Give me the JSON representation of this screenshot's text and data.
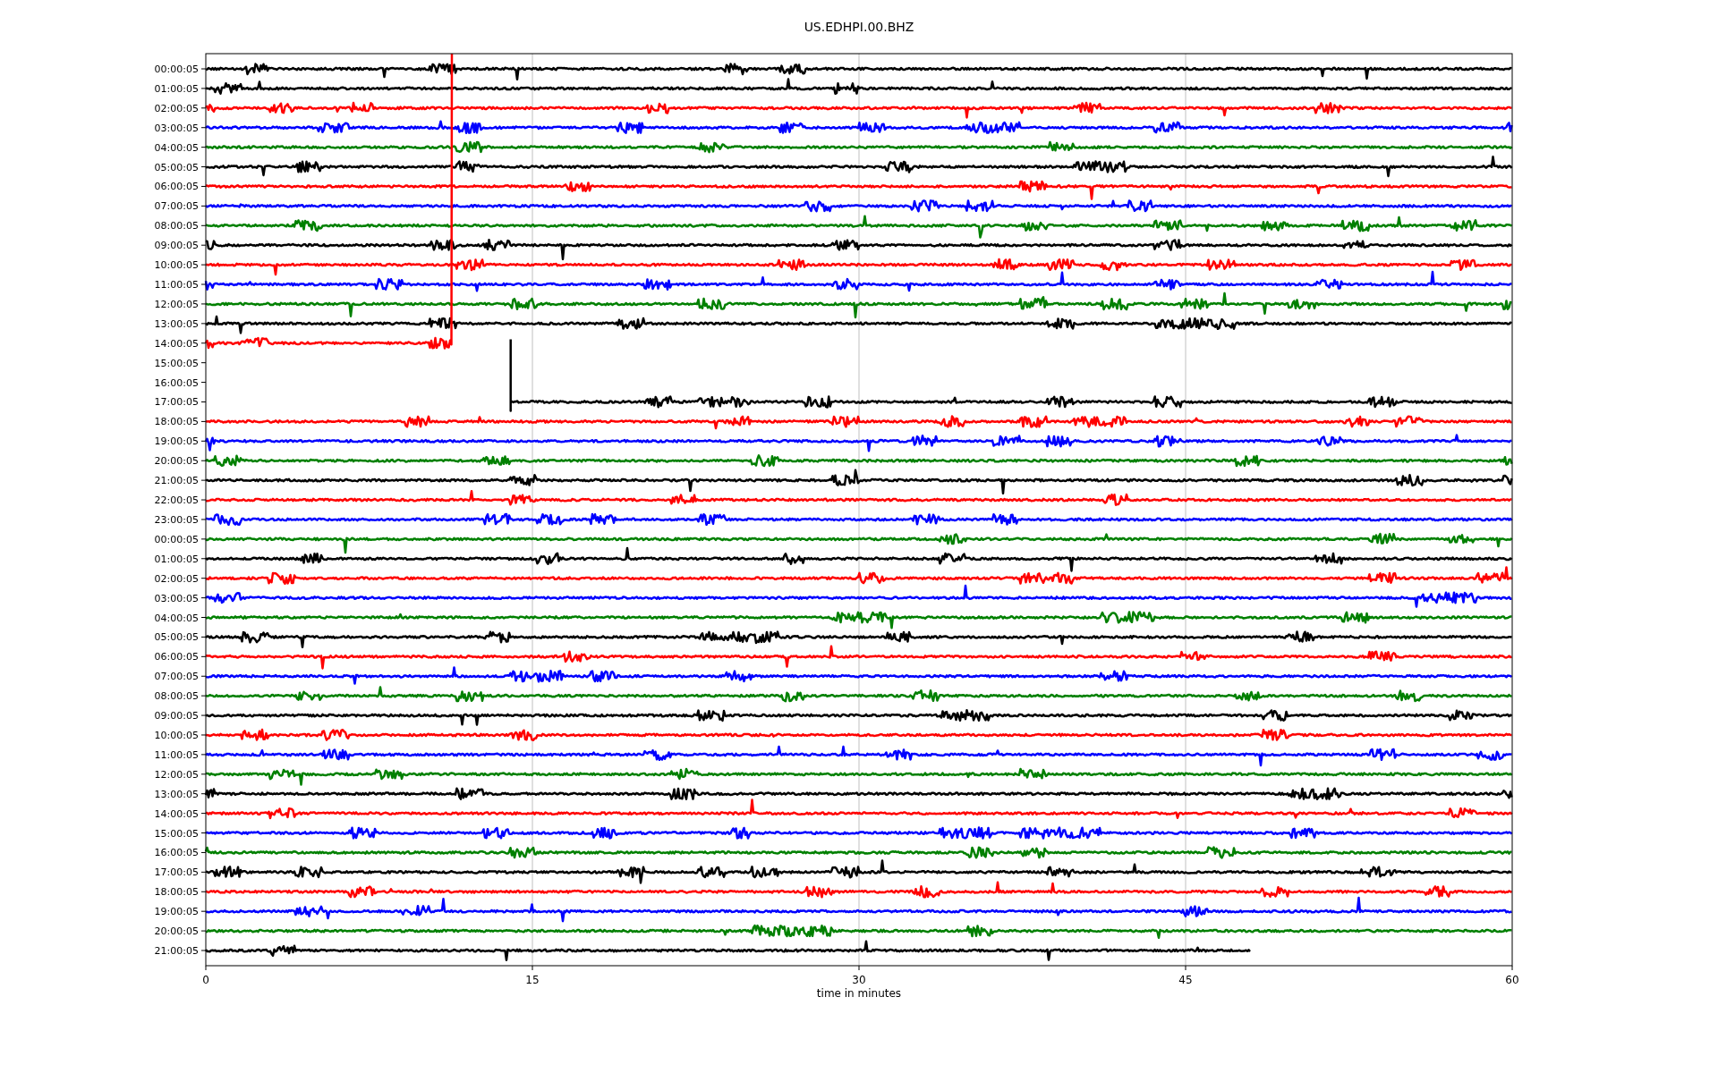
{
  "title": "US.EDHPI.00.BHZ",
  "xlabel": "time in minutes",
  "xticks": [
    "0",
    "15",
    "30",
    "45",
    "60"
  ],
  "rows": [
    {
      "label": "00:00:05",
      "color": "#000000",
      "kind": "full"
    },
    {
      "label": "01:00:05",
      "color": "#000000",
      "kind": "full"
    },
    {
      "label": "02:00:05",
      "color": "#ff0000",
      "kind": "full"
    },
    {
      "label": "03:00:05",
      "color": "#0000ff",
      "kind": "full"
    },
    {
      "label": "04:00:05",
      "color": "#008000",
      "kind": "full"
    },
    {
      "label": "05:00:05",
      "color": "#000000",
      "kind": "full"
    },
    {
      "label": "06:00:05",
      "color": "#ff0000",
      "kind": "full"
    },
    {
      "label": "07:00:05",
      "color": "#0000ff",
      "kind": "full"
    },
    {
      "label": "08:00:05",
      "color": "#008000",
      "kind": "full"
    },
    {
      "label": "09:00:05",
      "color": "#000000",
      "kind": "full"
    },
    {
      "label": "10:00:05",
      "color": "#ff0000",
      "kind": "full"
    },
    {
      "label": "11:00:05",
      "color": "#0000ff",
      "kind": "full"
    },
    {
      "label": "12:00:05",
      "color": "#008000",
      "kind": "full"
    },
    {
      "label": "13:00:05",
      "color": "#000000",
      "kind": "full"
    },
    {
      "label": "14:00:05",
      "color": "#ff0000",
      "kind": "short"
    },
    {
      "label": "15:00:05",
      "kind": "none"
    },
    {
      "label": "16:00:05",
      "kind": "none"
    },
    {
      "label": "17:00:05",
      "color": "#000000",
      "kind": "late-start"
    },
    {
      "label": "18:00:05",
      "color": "#ff0000",
      "kind": "full"
    },
    {
      "label": "19:00:05",
      "color": "#0000ff",
      "kind": "full"
    },
    {
      "label": "20:00:05",
      "color": "#008000",
      "kind": "full"
    },
    {
      "label": "21:00:05",
      "color": "#000000",
      "kind": "full"
    },
    {
      "label": "22:00:05",
      "color": "#ff0000",
      "kind": "full"
    },
    {
      "label": "23:00:05",
      "color": "#0000ff",
      "kind": "full"
    },
    {
      "label": "00:00:05",
      "color": "#008000",
      "kind": "full"
    },
    {
      "label": "01:00:05",
      "color": "#000000",
      "kind": "full"
    },
    {
      "label": "02:00:05",
      "color": "#ff0000",
      "kind": "full"
    },
    {
      "label": "03:00:05",
      "color": "#0000ff",
      "kind": "full"
    },
    {
      "label": "04:00:05",
      "color": "#008000",
      "kind": "full"
    },
    {
      "label": "05:00:05",
      "color": "#000000",
      "kind": "full"
    },
    {
      "label": "06:00:05",
      "color": "#ff0000",
      "kind": "full"
    },
    {
      "label": "07:00:05",
      "color": "#0000ff",
      "kind": "full"
    },
    {
      "label": "08:00:05",
      "color": "#008000",
      "kind": "full"
    },
    {
      "label": "09:00:05",
      "color": "#000000",
      "kind": "full"
    },
    {
      "label": "10:00:05",
      "color": "#ff0000",
      "kind": "full"
    },
    {
      "label": "11:00:05",
      "color": "#0000ff",
      "kind": "full"
    },
    {
      "label": "12:00:05",
      "color": "#008000",
      "kind": "full"
    },
    {
      "label": "13:00:05",
      "color": "#000000",
      "kind": "full"
    },
    {
      "label": "14:00:05",
      "color": "#ff0000",
      "kind": "full"
    },
    {
      "label": "15:00:05",
      "color": "#0000ff",
      "kind": "full"
    },
    {
      "label": "16:00:05",
      "color": "#008000",
      "kind": "full"
    },
    {
      "label": "17:00:05",
      "color": "#000000",
      "kind": "full"
    },
    {
      "label": "18:00:05",
      "color": "#ff0000",
      "kind": "full"
    },
    {
      "label": "19:00:05",
      "color": "#0000ff",
      "kind": "full"
    },
    {
      "label": "20:00:05",
      "color": "#008000",
      "kind": "full"
    },
    {
      "label": "21:00:05",
      "color": "#000000",
      "kind": "early-end"
    }
  ]
}
